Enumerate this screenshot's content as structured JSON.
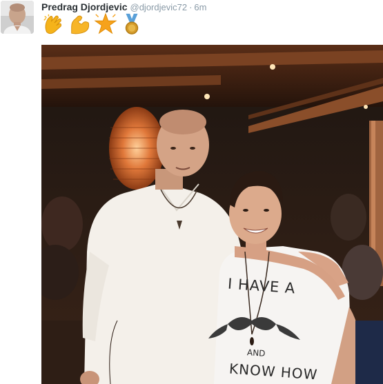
{
  "tweet": {
    "display_name": "Predrag Djordjevic",
    "handle": "@djordjevic72",
    "separator": "·",
    "time": "6m",
    "emojis": [
      "clapping-hands",
      "flexed-biceps",
      "glowing-star",
      "medal"
    ],
    "photo": {
      "shirt_text_line1": "I HAVE A",
      "shirt_text_line2": "AND",
      "shirt_text_line3": "KNOW HOW"
    }
  },
  "colors": {
    "name": "#292f33",
    "meta": "#8899a6",
    "clap": "#f5b31a",
    "biceps": "#f7b528",
    "star": "#f6a21c",
    "medal_ribbon": "#5aa0d8",
    "medal": "#d49b2a"
  }
}
